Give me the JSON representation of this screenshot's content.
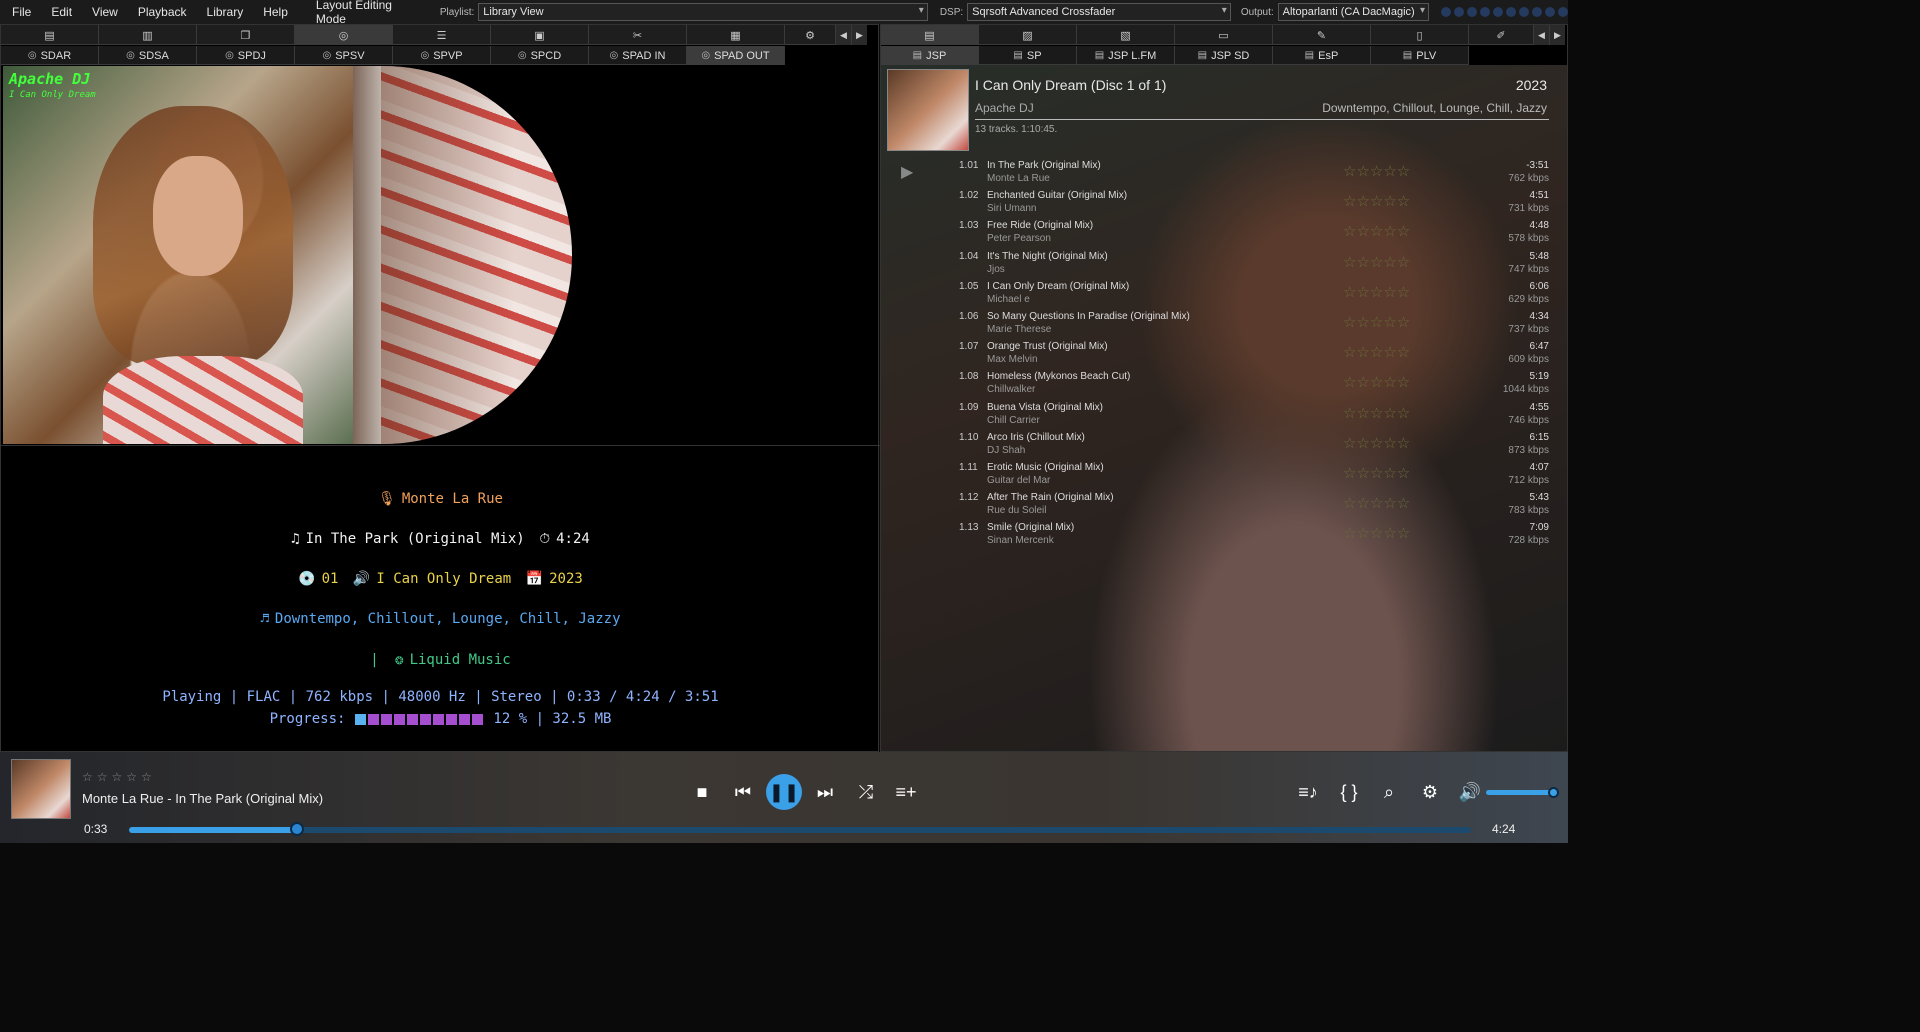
{
  "menu": [
    "File",
    "Edit",
    "View",
    "Playback",
    "Library",
    "Help"
  ],
  "layout_mode": "Layout Editing Mode",
  "playlist_label": "Playlist:",
  "playlist_value": "Library View",
  "dsp_label": "DSP:",
  "dsp_value": "Sqrsoft Advanced Crossfader",
  "output_label": "Output:",
  "output_value": "Altoparlanti (CA DacMagic)",
  "left_tabs": [
    "SDAR",
    "SDSA",
    "SPDJ",
    "SPSV",
    "SPVP",
    "SPCD",
    "SPAD IN",
    "SPAD OUT"
  ],
  "right_tabs": [
    "JSP",
    "SP",
    "JSP L.FM",
    "JSP SD",
    "EsP",
    "PLV"
  ],
  "art": {
    "title": "Apache DJ",
    "subtitle": "I Can Only Dream"
  },
  "info": {
    "artist": "Monte La Rue",
    "track": "In The Park (Original Mix)",
    "track_len": "4:24",
    "disc": "01",
    "album": "I Can Only Dream",
    "year": "2023",
    "genre": "Downtempo, Chillout, Lounge, Chill, Jazzy",
    "label_sep": "|",
    "label": "Liquid Music",
    "status": "Playing | FLAC | 762 kbps | 48000 Hz | Stereo | 0:33 / 4:24 / 3:51",
    "progress_label": "Progress:",
    "progress_value": "12 % | 32.5 MB",
    "progress_fraction": 0.12
  },
  "album_header": {
    "title": "I Can Only Dream (Disc 1 of 1)",
    "year": "2023",
    "artist": "Apache DJ",
    "genre": "Downtempo, Chillout, Lounge, Chill, Jazzy",
    "stats": "13 tracks. 1:10:45."
  },
  "tracks": [
    {
      "num": "1.01",
      "title": "In The Park (Original Mix)",
      "artist": "Monte La Rue",
      "dur": "-3:51",
      "kbps": "762 kbps"
    },
    {
      "num": "1.02",
      "title": "Enchanted Guitar (Original Mix)",
      "artist": "Siri Umann",
      "dur": "4:51",
      "kbps": "731 kbps"
    },
    {
      "num": "1.03",
      "title": "Free Ride (Original Mix)",
      "artist": "Peter Pearson",
      "dur": "4:48",
      "kbps": "578 kbps"
    },
    {
      "num": "1.04",
      "title": "It's The Night (Original Mix)",
      "artist": "Jjos",
      "dur": "5:48",
      "kbps": "747 kbps"
    },
    {
      "num": "1.05",
      "title": "I Can Only Dream (Original Mix)",
      "artist": "Michael e",
      "dur": "6:06",
      "kbps": "629 kbps"
    },
    {
      "num": "1.06",
      "title": "So Many Questions In Paradise (Original Mix)",
      "artist": "Marie Therese",
      "dur": "4:34",
      "kbps": "737 kbps"
    },
    {
      "num": "1.07",
      "title": "Orange Trust (Original Mix)",
      "artist": "Max Melvin",
      "dur": "6:47",
      "kbps": "609 kbps"
    },
    {
      "num": "1.08",
      "title": "Homeless (Mykonos Beach Cut)",
      "artist": "Chillwalker",
      "dur": "5:19",
      "kbps": "1044 kbps"
    },
    {
      "num": "1.09",
      "title": "Buena Vista (Original Mix)",
      "artist": "Chill Carrier",
      "dur": "4:55",
      "kbps": "746 kbps"
    },
    {
      "num": "1.10",
      "title": "Arco Iris (Chillout Mix)",
      "artist": "DJ Shah",
      "dur": "6:15",
      "kbps": "873 kbps"
    },
    {
      "num": "1.11",
      "title": "Erotic Music (Original Mix)",
      "artist": "Guitar del Mar",
      "dur": "4:07",
      "kbps": "712 kbps"
    },
    {
      "num": "1.12",
      "title": "After The Rain (Original Mix)",
      "artist": "Rue du Soleil",
      "dur": "5:43",
      "kbps": "783 kbps"
    },
    {
      "num": "1.13",
      "title": "Smile (Original Mix)",
      "artist": "Sinan Mercenk",
      "dur": "7:09",
      "kbps": "728 kbps"
    }
  ],
  "player": {
    "now_playing": "Monte La Rue - In The Park (Original Mix)",
    "time_current": "0:33",
    "time_total": "4:24",
    "seek_fraction": 0.125,
    "volume_fraction": 1.0,
    "star_glyphs": "☆☆☆☆☆"
  },
  "colors": {
    "accent": "#3aa0e8",
    "progress_filled": "#5ab2f0",
    "progress_empty": "#a54fd0",
    "art_text": "#42ff3c"
  }
}
